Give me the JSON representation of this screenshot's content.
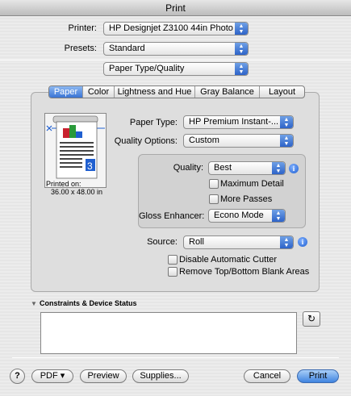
{
  "window": {
    "title": "Print"
  },
  "printer": {
    "label": "Printer:",
    "value": "HP Designjet Z3100 44in Photo"
  },
  "presets": {
    "label": "Presets:",
    "value": "Standard"
  },
  "section": {
    "value": "Paper Type/Quality"
  },
  "tabs": [
    {
      "label": "Paper",
      "active": true
    },
    {
      "label": "Color",
      "active": false
    },
    {
      "label": "Lightness and Hue",
      "active": false
    },
    {
      "label": "Gray Balance",
      "active": false
    },
    {
      "label": "Layout",
      "active": false
    }
  ],
  "preview": {
    "printed_on_label": "Printed on:",
    "size": "36.00 x 48.00 in"
  },
  "paper_type": {
    "label": "Paper Type:",
    "value": "HP Premium Instant-..."
  },
  "quality_options": {
    "label": "Quality Options:",
    "value": "Custom"
  },
  "quality": {
    "label": "Quality:",
    "value": "Best"
  },
  "maximum_detail": {
    "label": "Maximum Detail",
    "checked": false
  },
  "more_passes": {
    "label": "More Passes",
    "checked": false
  },
  "gloss_enhancer": {
    "label": "Gloss Enhancer:",
    "value": "Econo Mode"
  },
  "source": {
    "label": "Source:",
    "value": "Roll"
  },
  "disable_cutter": {
    "label": "Disable Automatic Cutter",
    "checked": false
  },
  "remove_blank": {
    "label": "Remove Top/Bottom Blank Areas",
    "checked": false
  },
  "constraints": {
    "label": "Constraints & Device Status"
  },
  "footer": {
    "help": "?",
    "pdf": "PDF ▾",
    "preview": "Preview",
    "supplies": "Supplies...",
    "cancel": "Cancel",
    "print": "Print"
  },
  "colors": {
    "accent": "#3a74d4",
    "panel": "#dedede"
  }
}
